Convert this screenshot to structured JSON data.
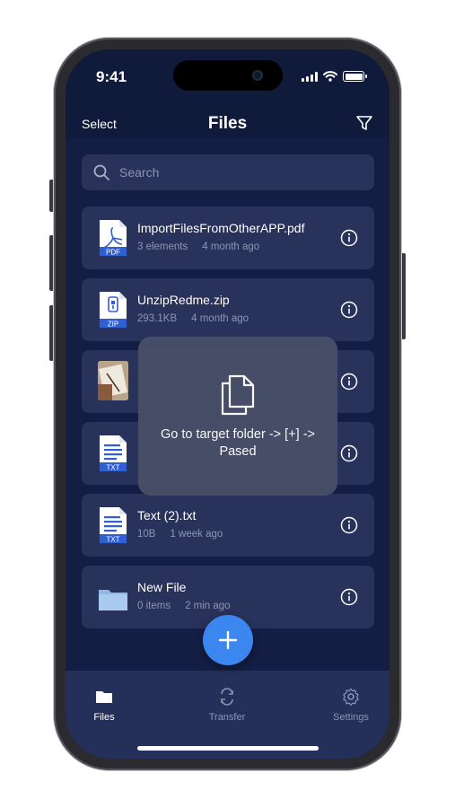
{
  "status_bar": {
    "time": "9:41"
  },
  "header": {
    "select_label": "Select",
    "title": "Files",
    "filter_icon": "filter-icon"
  },
  "search": {
    "placeholder": "Search"
  },
  "files": [
    {
      "name": "ImportFilesFromOtherAPP.pdf",
      "meta1": "3 elements",
      "meta2": "4 month ago",
      "icon": "pdf-file-icon",
      "badge": "PDF"
    },
    {
      "name": "UnzipRedme.zip",
      "meta1": "293.1KB",
      "meta2": "4 month ago",
      "icon": "zip-file-icon",
      "badge": "ZIP"
    },
    {
      "name": "",
      "meta1": "",
      "meta2": "",
      "icon": "image-thumbnail"
    },
    {
      "name": "",
      "meta1": "",
      "meta2": "",
      "icon": "txt-file-icon",
      "badge": "TXT"
    },
    {
      "name": "Text (2).txt",
      "meta1": "10B",
      "meta2": "1 week ago",
      "icon": "txt-file-icon",
      "badge": "TXT"
    },
    {
      "name": "New File",
      "meta1": "0 items",
      "meta2": "2 min ago",
      "icon": "folder-icon"
    }
  ],
  "toast": {
    "message": "Go to target folder -> [+] -> Pased",
    "icon": "copy-icon"
  },
  "fab": {
    "icon": "plus-icon"
  },
  "tabbar": [
    {
      "label": "Files",
      "icon": "folder-icon",
      "active": true
    },
    {
      "label": "Transfer",
      "icon": "transfer-icon",
      "active": false
    },
    {
      "label": "Settings",
      "icon": "gear-icon",
      "active": false
    }
  ],
  "colors": {
    "background": "#141e45",
    "card": "#28325a",
    "accent": "#3b86ef",
    "tabbar": "#25305a"
  }
}
